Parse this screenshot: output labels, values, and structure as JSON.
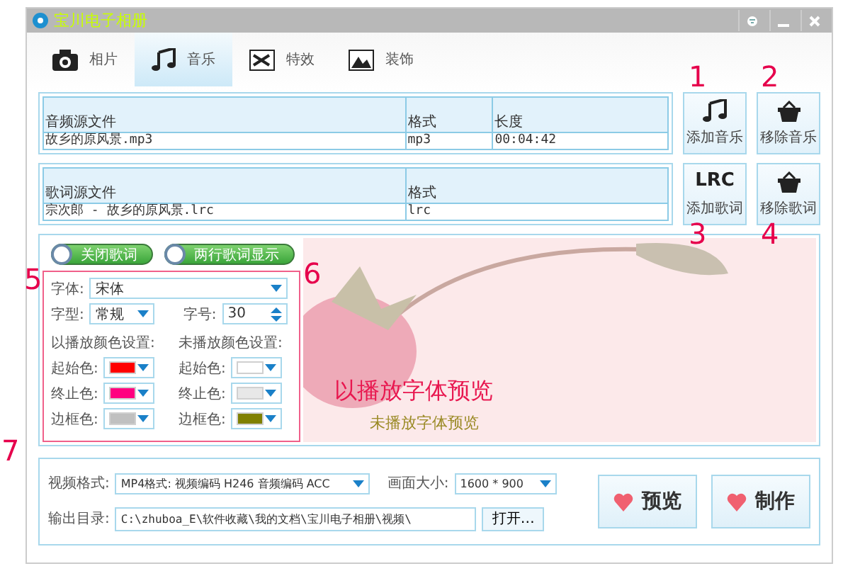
{
  "window": {
    "title": "宝川电子相册"
  },
  "tabs": [
    {
      "label": "相片",
      "kind": "camera",
      "selected": false
    },
    {
      "label": "音乐",
      "kind": "music",
      "selected": true
    },
    {
      "label": "特效",
      "kind": "effect",
      "selected": false
    },
    {
      "label": "装饰",
      "kind": "picture",
      "selected": false
    }
  ],
  "audio_table": {
    "columns": [
      "音频源文件",
      "格式",
      "长度"
    ],
    "rows": [
      [
        "故乡的原风景.mp3",
        "mp3",
        "00:04:42"
      ]
    ]
  },
  "audio_buttons": [
    {
      "label": "添加音乐",
      "kind": "add-music"
    },
    {
      "label": "移除音乐",
      "kind": "remove"
    }
  ],
  "lyrics_table": {
    "columns": [
      "歌词源文件",
      "格式"
    ],
    "rows": [
      [
        "宗次郎 - 故乡的原风景.lrc",
        "lrc"
      ]
    ]
  },
  "lyrics_buttons": [
    {
      "label": "添加歌词",
      "kind": "add-lrc",
      "icon_text": "LRC"
    },
    {
      "label": "移除歌词",
      "kind": "remove"
    }
  ],
  "toggles": [
    {
      "label": "关闭歌词",
      "on": true
    },
    {
      "label": "两行歌词显示",
      "on": true
    }
  ],
  "font": {
    "label": "字体:",
    "value": "宋体"
  },
  "font_style": {
    "label": "字型:",
    "value": "常规"
  },
  "font_size": {
    "label": "字号:",
    "value": "30"
  },
  "color_groups": [
    {
      "title": "以播放颜色设置:",
      "items": [
        {
          "label": "起始色:",
          "color": "#ff0000"
        },
        {
          "label": "终止色:",
          "color": "#ff0080"
        },
        {
          "label": "边框色:",
          "color": "#c0c0c0"
        }
      ]
    },
    {
      "title": "未播放颜色设置:",
      "items": [
        {
          "label": "起始色:",
          "color": "#ffffff"
        },
        {
          "label": "终止色:",
          "color": "#e8e8e8"
        },
        {
          "label": "边框色:",
          "color": "#808000"
        }
      ]
    }
  ],
  "preview": {
    "played_text": "以播放字体预览",
    "unplayed_text": "未播放字体预览"
  },
  "video_format": {
    "label": "视频格式:",
    "value": "MP4格式: 视频编码 H246 音频编码 ACC"
  },
  "frame_size": {
    "label": "画面大小:",
    "value": "1600 * 900"
  },
  "output_dir": {
    "label": "输出目录:",
    "value": "C:\\zhuboa_E\\软件收藏\\我的文档\\宝川电子相册\\视频\\",
    "button": "打开…"
  },
  "actions": [
    "预览",
    "制作"
  ],
  "annotations": [
    "1",
    "2",
    "3",
    "4",
    "5",
    "6",
    "7"
  ]
}
